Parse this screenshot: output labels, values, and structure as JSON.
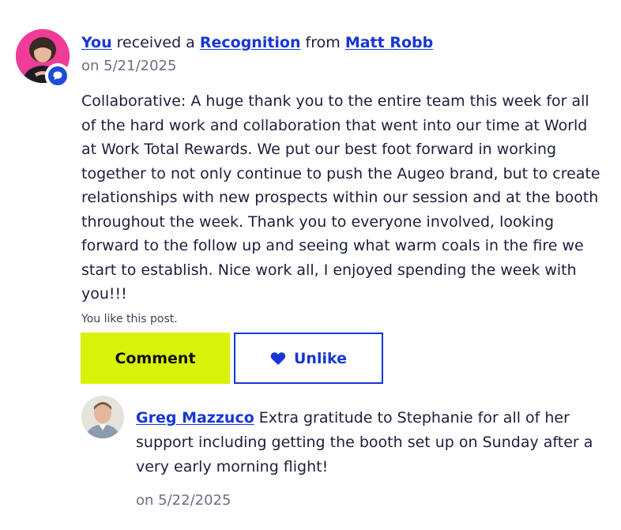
{
  "post": {
    "author_link": "You",
    "text_received": " received a ",
    "type_link": "Recognition",
    "text_from": " from ",
    "sender_link": "Matt Robb",
    "date": "on 5/21/2025",
    "body": "Collaborative: A huge thank you to the entire team this week for all of the hard work and collaboration that went into our time at World at Work Total Rewards. We put our best foot forward in working together to not only continue to push the Augeo brand, but to create relationships with new prospects within our session and at the booth throughout the week. Thank you to everyone involved, looking forward to the follow up and seeing what warm coals in the fire we start to establish. Nice work all, I enjoyed spending the week with you!!!",
    "like_status": "You like this post.",
    "avatar_badge_icon": "comment-bubble-icon",
    "colors": {
      "link": "#1736d6",
      "avatar_bg": "#ef3c97",
      "badge": "#1f4bd8",
      "comment_button": "#d9f20a"
    }
  },
  "actions": {
    "comment_label": "Comment",
    "unlike_label": "Unlike",
    "unlike_icon": "heart-icon"
  },
  "comment": {
    "author_link": "Greg Mazzuco",
    "text": " Extra gratitude to Stephanie for all of her support including getting the booth set up on Sunday after a very early morning flight!",
    "date": "on 5/22/2025"
  }
}
